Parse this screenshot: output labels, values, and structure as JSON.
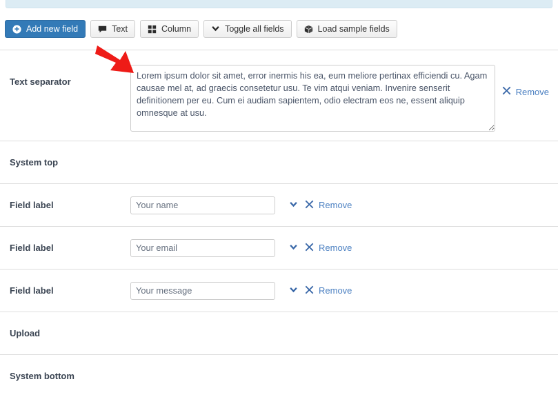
{
  "info_bar": {
    "text": ""
  },
  "toolbar": {
    "buttons": [
      {
        "label": "Add new field",
        "icon": "plus-circle-icon",
        "style": "primary"
      },
      {
        "label": "Text",
        "icon": "comment-icon",
        "style": "default"
      },
      {
        "label": "Column",
        "icon": "grid-icon",
        "style": "default"
      },
      {
        "label": "Toggle all fields",
        "icon": "chevron-down-icon",
        "style": "default"
      },
      {
        "label": "Load sample fields",
        "icon": "cube-icon",
        "style": "default"
      }
    ]
  },
  "rows": [
    {
      "type": "separator",
      "label": "Text separator",
      "textarea_value": "Lorem ipsum dolor sit amet, error inermis his ea, eum meliore pertinax efficiendi cu. Agam causae mel at, ad graecis consetetur usu. Te vim atqui veniam. Invenire senserit definitionem per eu. Cum ei audiam sapientem, odio electram eos ne, essent aliquip omnesque at usu.",
      "remove_label": "Remove"
    },
    {
      "type": "heading",
      "label": "System top"
    },
    {
      "type": "field",
      "label": "Field label",
      "value": "Your name",
      "remove_label": "Remove"
    },
    {
      "type": "field",
      "label": "Field label",
      "value": "Your email",
      "remove_label": "Remove"
    },
    {
      "type": "field",
      "label": "Field label",
      "value": "Your message",
      "remove_label": "Remove"
    },
    {
      "type": "heading",
      "label": "Upload"
    },
    {
      "type": "heading",
      "label": "System bottom"
    }
  ],
  "annotation": {
    "arrow_color": "#ee1b17"
  },
  "colors": {
    "primary_button": "#337ab7",
    "link": "#4a7fc1",
    "icon_blue": "#3a68a8",
    "label": "#3a4452",
    "divider": "#dddddd",
    "info_bar": "#dcecf4"
  }
}
